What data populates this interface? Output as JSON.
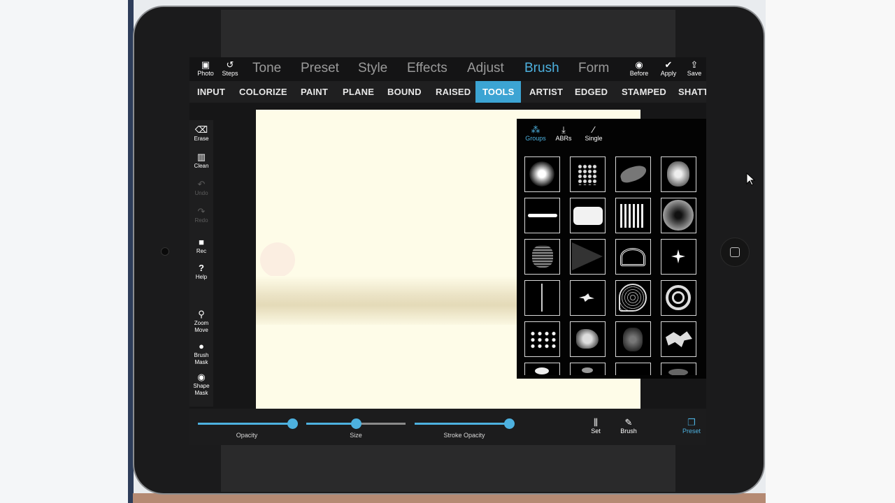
{
  "topbar": {
    "photo": "Photo",
    "steps": "Steps",
    "before": "Before",
    "apply": "Apply",
    "save": "Save"
  },
  "nav": {
    "items": [
      "Tone",
      "Preset",
      "Style",
      "Effects",
      "Adjust",
      "Brush",
      "Form"
    ],
    "active": "Brush"
  },
  "subnav": {
    "items": [
      "INPUT",
      "COLORIZE",
      "PAINT",
      "PLANE",
      "BOUND",
      "RAISED",
      "TOOLS",
      "ARTIST",
      "EDGED",
      "STAMPED",
      "SHATT"
    ],
    "active": "TOOLS"
  },
  "sidebar": {
    "erase": "Erase",
    "clean": "Clean",
    "undo": "Undo",
    "redo": "Redo",
    "rec": "Rec",
    "help": "Help",
    "zoom_move": [
      "Zoom",
      "Move"
    ],
    "brush_mask": [
      "Brush",
      "Mask"
    ],
    "shape_mask": [
      "Shape",
      "Mask"
    ]
  },
  "brush_panel": {
    "tabs": [
      "Groups",
      "ABRs",
      "Single"
    ],
    "active_tab": "Groups"
  },
  "bottom": {
    "sliders": [
      {
        "label": "Opacity",
        "value": 1.0
      },
      {
        "label": "Size",
        "value": 0.5
      },
      {
        "label": "Stroke Opacity",
        "value": 1.0
      }
    ],
    "set": "Set",
    "brush": "Brush",
    "preset": "Preset"
  },
  "colors": {
    "accent": "#3ca4d3",
    "canvas": "#fefce8"
  }
}
